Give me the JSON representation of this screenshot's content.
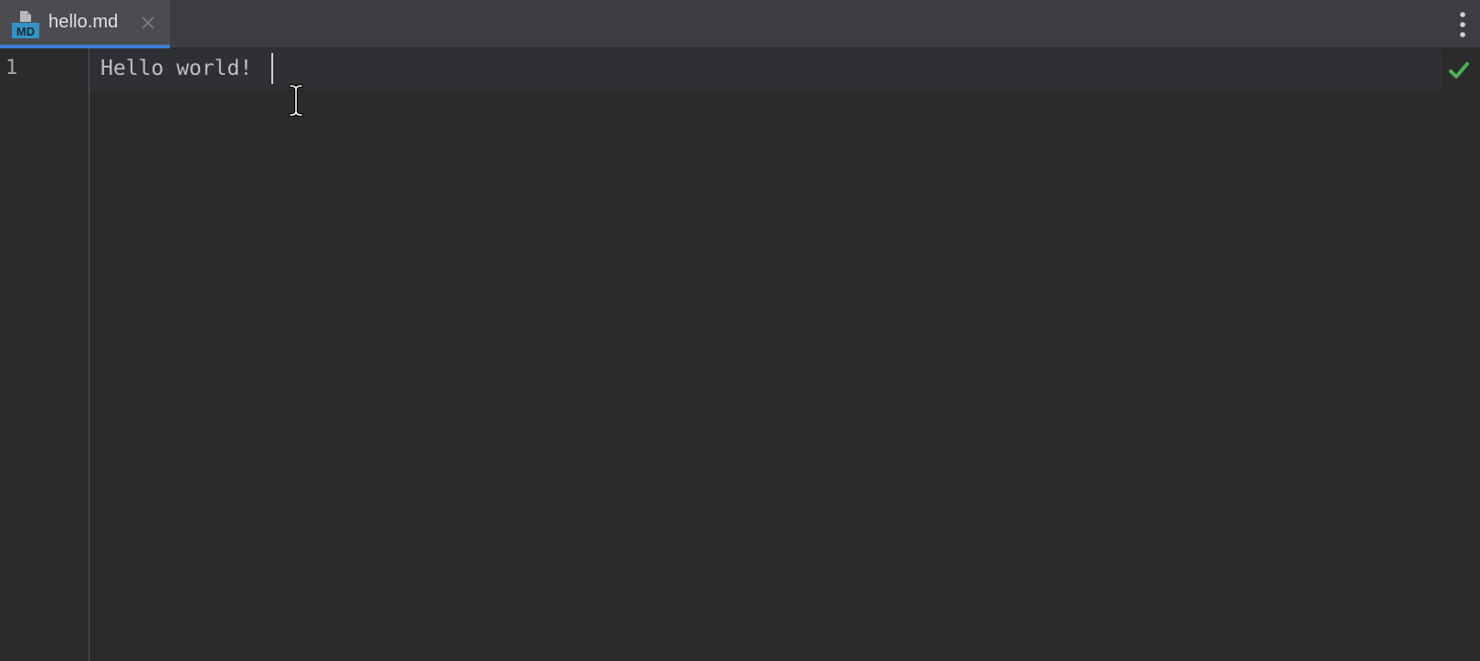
{
  "tabs": [
    {
      "label": "hello.md",
      "icon": "markdown-file-icon",
      "icon_text": "MD",
      "active": true
    }
  ],
  "editor": {
    "lines": [
      {
        "number": "1",
        "text": "Hello world!"
      }
    ],
    "status_icon": "checkmark-icon"
  },
  "colors": {
    "accent": "#3d7fd6",
    "tabbar_bg": "#3c3d41",
    "active_tab_bg": "#4a4c50",
    "editor_bg": "#2b2b2d",
    "text": "#bcbec4",
    "ok_green": "#4caf50"
  }
}
